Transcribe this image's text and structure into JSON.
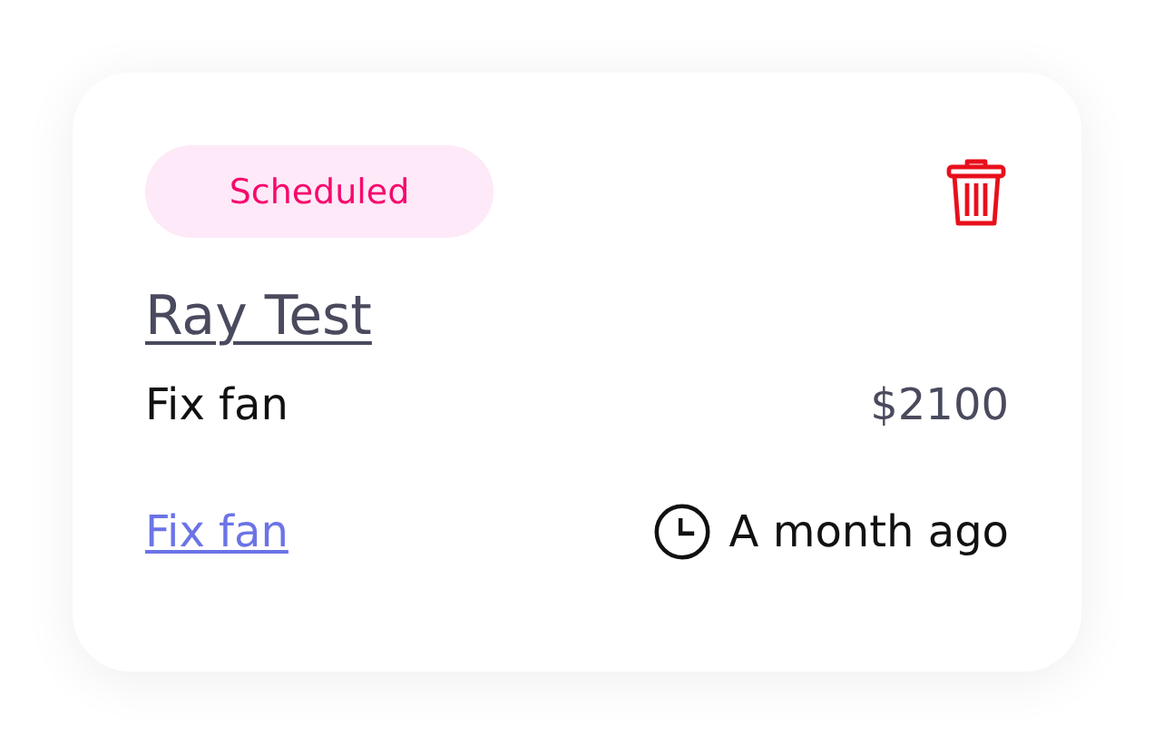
{
  "card": {
    "status": {
      "label": "Scheduled",
      "kind": "scheduled"
    },
    "customer": "Ray Test",
    "job": "Fix fan",
    "price": "$2100",
    "link": "Fix fan",
    "time": "A month ago"
  }
}
